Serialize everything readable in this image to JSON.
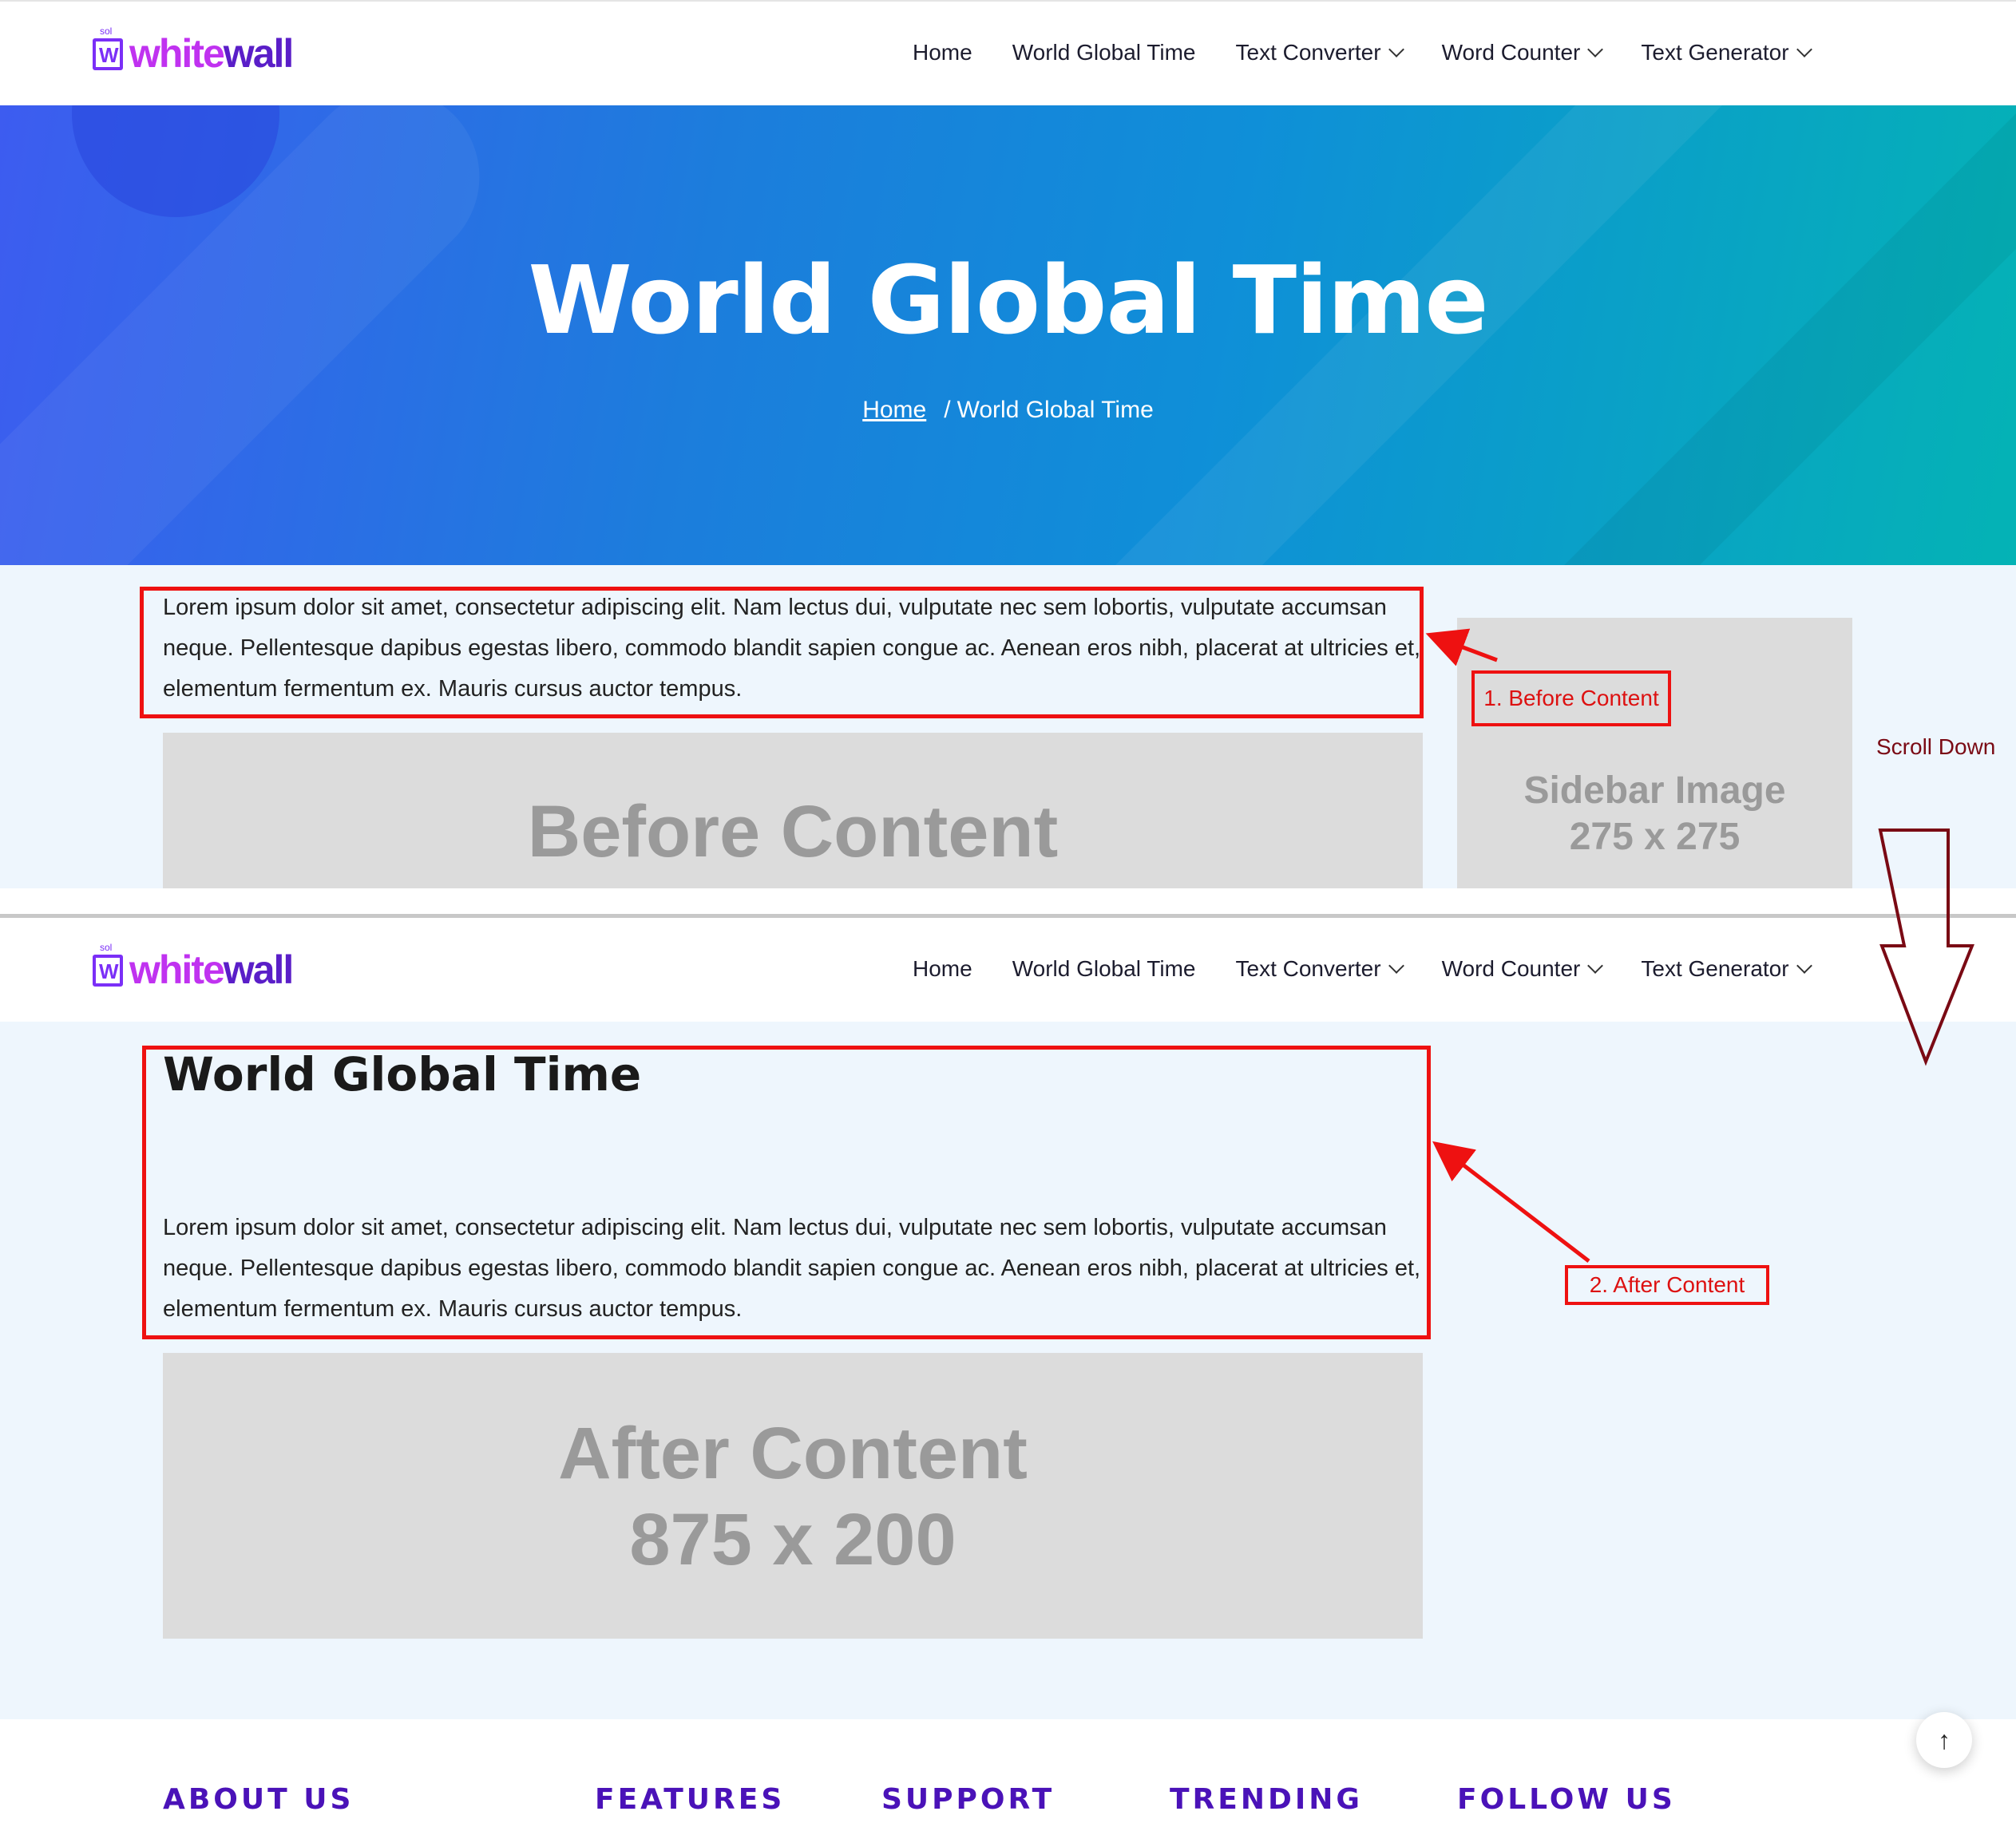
{
  "brand": {
    "sol": "sol",
    "mark": "W",
    "part1": "white",
    "part2": "wall"
  },
  "nav": {
    "items": [
      {
        "label": "Home",
        "dropdown": false
      },
      {
        "label": "World Global Time",
        "dropdown": false
      },
      {
        "label": "Text Converter",
        "dropdown": true
      },
      {
        "label": "Word Counter",
        "dropdown": true
      },
      {
        "label": "Text Generator",
        "dropdown": true
      }
    ]
  },
  "hero": {
    "title": "World Global Time",
    "breadcrumb_home": "Home",
    "breadcrumb_sep": "/",
    "breadcrumb_current": "World Global Time"
  },
  "lorem": "Lorem ipsum dolor sit amet, consectetur adipiscing elit. Nam lectus dui, vulputate nec sem lobortis, vulputate accumsan neque. Pellentesque dapibus egestas libero, commodo blandit sapien congue ac. Aenean eros nibh, placerat at ultricies et, elementum fermentum ex. Mauris cursus auctor tempus.",
  "before_placeholder": {
    "line1": "Before Content"
  },
  "sidebar_placeholder": {
    "line1": "Sidebar Image",
    "line2": "275 x 275"
  },
  "annotations": {
    "before": "1. Before Content",
    "after": "2. After Content",
    "scroll": "Scroll Down"
  },
  "second_section": {
    "title": "World Global Time"
  },
  "after_placeholder": {
    "line1": "After Content",
    "line2": "875 x 200"
  },
  "footer": {
    "headings": [
      "ABOUT US",
      "FEATURES",
      "SUPPORT",
      "TRENDING",
      "FOLLOW US"
    ]
  },
  "to_top_icon": "arrow-up-icon",
  "colors": {
    "annotation_red": "#ee1111",
    "footer_heading": "#4a12b8",
    "brand_pink": "#c032f0",
    "brand_purple": "#5a1ec8"
  }
}
